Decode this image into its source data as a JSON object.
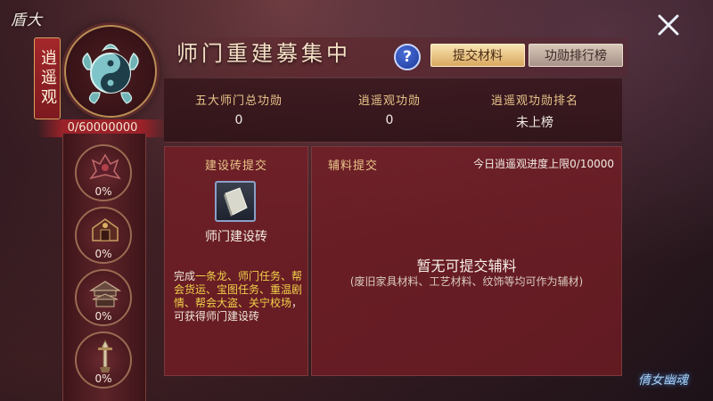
{
  "top_logo": "盾大",
  "corner_logo": "倩女幽魂",
  "school": {
    "name": "逍遥观",
    "total_progress": "0/60000000"
  },
  "tiers": [
    {
      "percent": "0%",
      "icon": "demon-crest-icon"
    },
    {
      "percent": "0%",
      "icon": "ornate-gate-icon"
    },
    {
      "percent": "0%",
      "icon": "pavilion-icon"
    },
    {
      "percent": "0%",
      "icon": "sword-tower-icon"
    }
  ],
  "header": {
    "title": "师门重建募集中",
    "help": "?",
    "tabs": [
      {
        "label": "提交材料",
        "active": true
      },
      {
        "label": "功勋排行榜",
        "active": false
      }
    ]
  },
  "stats": [
    {
      "label": "五大师门总功勋",
      "value": "0"
    },
    {
      "label": "逍遥观功勋",
      "value": "0"
    },
    {
      "label": "逍遥观功勋排名",
      "value": "未上榜"
    }
  ],
  "brick_panel": {
    "heading": "建设砖提交",
    "item_name": "师门建设砖",
    "desc_prefix": "完成",
    "desc_highlight": "一条龙、师门任务、帮会货运、宝图任务、重温剧情、帮会大盗、关宁校场",
    "desc_suffix": "，可获得师门建设砖"
  },
  "aux_panel": {
    "heading": "辅料提交",
    "daily_limit": "今日逍遥观进度上限0/10000",
    "empty_text": "暂无可提交辅料",
    "hint": "(废旧家具材料、工艺材料、纹饰等均可作为辅材)"
  },
  "colors": {
    "accent_gold": "#e9c48a",
    "highlight_yellow": "#f2d14a",
    "panel_red": "#78202a"
  }
}
